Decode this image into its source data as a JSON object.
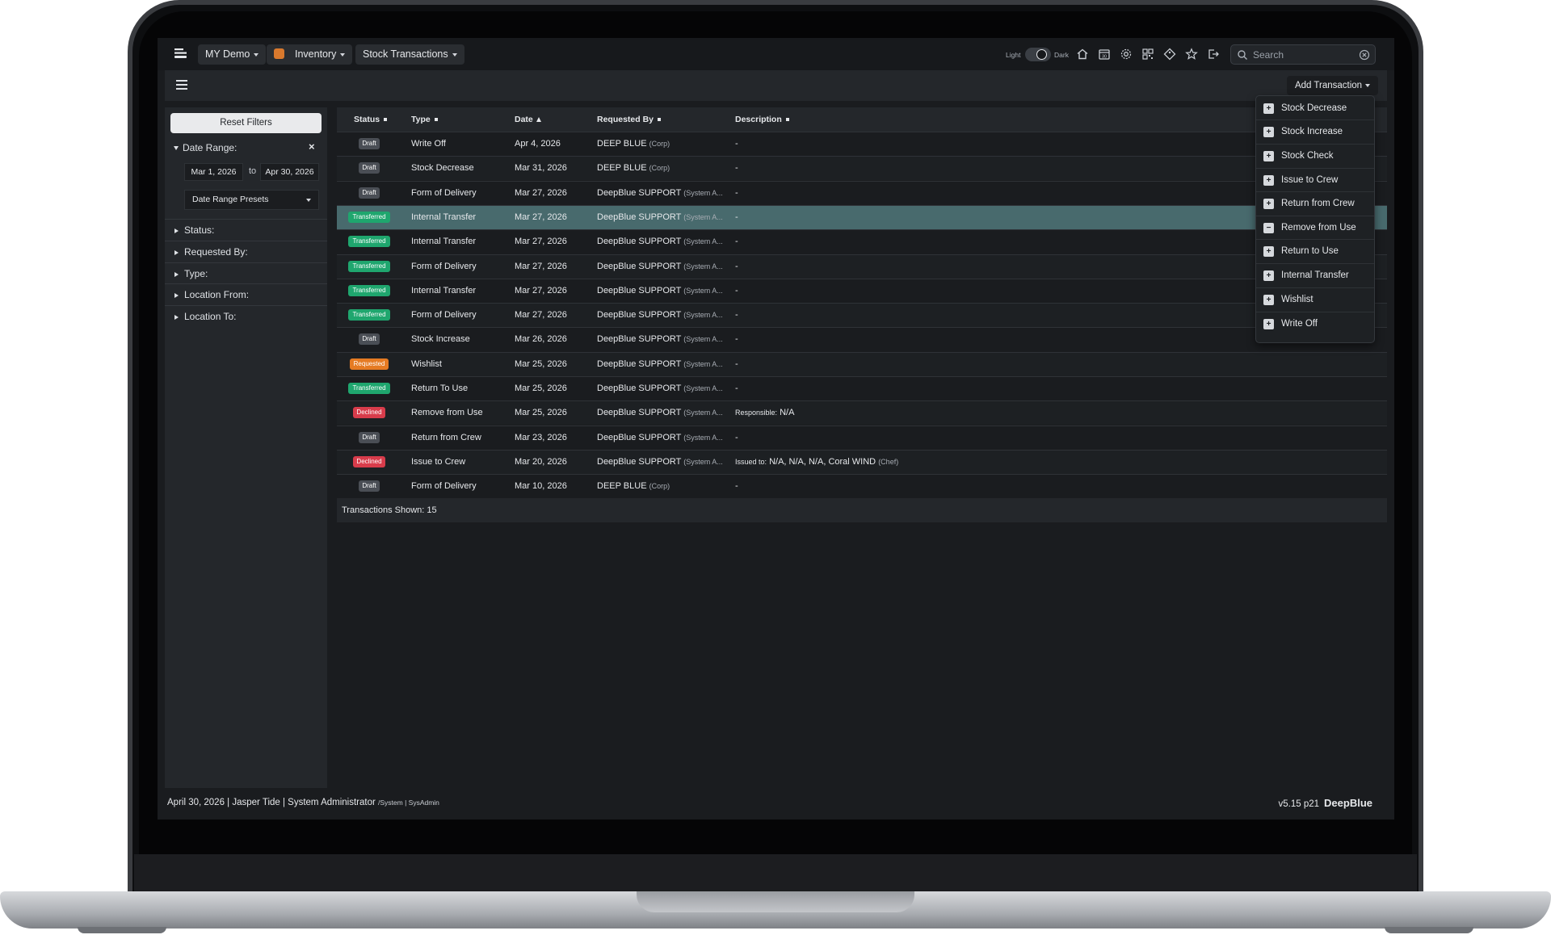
{
  "topbar": {
    "crumbs": [
      "MY Demo",
      "Inventory",
      "Stock Transactions"
    ],
    "theme_light": "Light",
    "theme_dark": "Dark",
    "search_placeholder": "Search"
  },
  "toolbar": {
    "add_transaction_label": "Add Transaction"
  },
  "sidebar": {
    "reset_label": "Reset Filters",
    "date_range_label": "Date Range:",
    "date_from": "Mar 1, 2026",
    "to_label": "to",
    "date_to": "Apr 30, 2026",
    "presets_label": "Date Range Presets",
    "filters": [
      "Status:",
      "Requested By:",
      "Type:",
      "Location From:",
      "Location To:"
    ]
  },
  "table": {
    "columns": [
      "Status",
      "Type",
      "Date",
      "Requested By",
      "Description"
    ],
    "rows": [
      {
        "status": "Draft",
        "type": "Write Off",
        "date": "Apr 4, 2026",
        "by": "DEEP BLUE",
        "by_sub": "(Corp)",
        "desc": "-",
        "desc_sub": ""
      },
      {
        "status": "Draft",
        "type": "Stock Decrease",
        "date": "Mar 31, 2026",
        "by": "DEEP BLUE",
        "by_sub": "(Corp)",
        "desc": "-",
        "desc_sub": ""
      },
      {
        "status": "Draft",
        "type": "Form of Delivery",
        "date": "Mar 27, 2026",
        "by": "DeepBlue SUPPORT",
        "by_sub": "(System A...",
        "desc": "-",
        "desc_sub": ""
      },
      {
        "status": "Transferred",
        "type": "Internal Transfer",
        "date": "Mar 27, 2026",
        "by": "DeepBlue SUPPORT",
        "by_sub": "(System A...",
        "desc": "-",
        "desc_sub": ""
      },
      {
        "status": "Transferred",
        "type": "Internal Transfer",
        "date": "Mar 27, 2026",
        "by": "DeepBlue SUPPORT",
        "by_sub": "(System A...",
        "desc": "-",
        "desc_sub": ""
      },
      {
        "status": "Transferred",
        "type": "Form of Delivery",
        "date": "Mar 27, 2026",
        "by": "DeepBlue SUPPORT",
        "by_sub": "(System A...",
        "desc": "-",
        "desc_sub": ""
      },
      {
        "status": "Transferred",
        "type": "Internal Transfer",
        "date": "Mar 27, 2026",
        "by": "DeepBlue SUPPORT",
        "by_sub": "(System A...",
        "desc": "-",
        "desc_sub": ""
      },
      {
        "status": "Transferred",
        "type": "Form of Delivery",
        "date": "Mar 27, 2026",
        "by": "DeepBlue SUPPORT",
        "by_sub": "(System A...",
        "desc": "-",
        "desc_sub": ""
      },
      {
        "status": "Draft",
        "type": "Stock Increase",
        "date": "Mar 26, 2026",
        "by": "DeepBlue SUPPORT",
        "by_sub": "(System A...",
        "desc": "-",
        "desc_sub": ""
      },
      {
        "status": "Requested",
        "type": "Wishlist",
        "date": "Mar 25, 2026",
        "by": "DeepBlue SUPPORT",
        "by_sub": "(System A...",
        "desc": "-",
        "desc_sub": ""
      },
      {
        "status": "Transferred",
        "type": "Return To Use",
        "date": "Mar 25, 2026",
        "by": "DeepBlue SUPPORT",
        "by_sub": "(System A...",
        "desc": "-",
        "desc_sub": ""
      },
      {
        "status": "Declined",
        "type": "Remove from Use",
        "date": "Mar 25, 2026",
        "by": "DeepBlue SUPPORT",
        "by_sub": "(System A...",
        "desc_prefix": "Responsible:",
        "desc": "N/A",
        "desc_sub": ""
      },
      {
        "status": "Draft",
        "type": "Return from Crew",
        "date": "Mar 23, 2026",
        "by": "DeepBlue SUPPORT",
        "by_sub": "(System A...",
        "desc": "-",
        "desc_sub": ""
      },
      {
        "status": "Declined",
        "type": "Issue to Crew",
        "date": "Mar 20, 2026",
        "by": "DeepBlue SUPPORT",
        "by_sub": "(System A...",
        "desc_prefix": "Issued to:",
        "desc": "N/A, N/A, N/A, Coral WIND",
        "desc_sub": "(Chef)"
      },
      {
        "status": "Draft",
        "type": "Form of Delivery",
        "date": "Mar 10, 2026",
        "by": "DEEP BLUE",
        "by_sub": "(Corp)",
        "desc": "-",
        "desc_sub": ""
      }
    ],
    "footer": "Transactions Shown: 15",
    "selected_row_index": 3
  },
  "status_colors": {
    "Draft": "#4a4e55",
    "Transferred": "#1fa66e",
    "Requested": "#e57b23",
    "Declined": "#d83c4b"
  },
  "menu": {
    "items": [
      {
        "label": "Stock Decrease",
        "icon": "plus-icon"
      },
      {
        "label": "Stock Increase",
        "icon": "plus-icon"
      },
      {
        "label": "Stock Check",
        "icon": "plus-icon"
      },
      {
        "label": "Issue to Crew",
        "icon": "plus-icon"
      },
      {
        "label": "Return from Crew",
        "icon": "plus-icon"
      },
      {
        "label": "Remove from Use",
        "icon": "minus-box-icon"
      },
      {
        "label": "Return to Use",
        "icon": "plus-icon"
      },
      {
        "label": "Internal Transfer",
        "icon": "plus-icon"
      },
      {
        "label": "Wishlist",
        "icon": "plus-icon"
      },
      {
        "label": "Write Off",
        "icon": "plus-icon"
      }
    ]
  },
  "statusbar": {
    "left_main": "April 30, 2026 | Jasper Tide | System Administrator",
    "left_small": "/System | SysAdmin",
    "version": "v5.15 p21",
    "brand": "DeepBlue"
  }
}
